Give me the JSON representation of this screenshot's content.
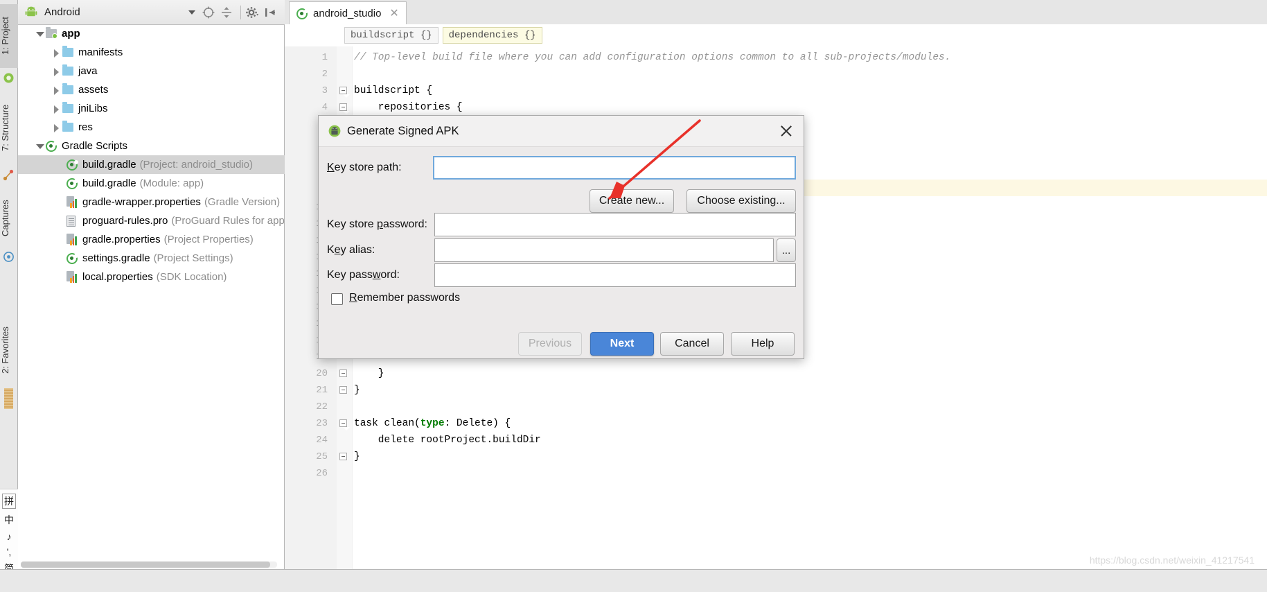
{
  "app": {
    "name": "Android Studio"
  },
  "left_strip": {
    "items": [
      {
        "label": "1: Project",
        "icon": "project-icon",
        "active": true
      },
      {
        "label": "7: Structure",
        "icon": "structure-icon",
        "active": false
      },
      {
        "label": "Captures",
        "icon": "captures-icon",
        "active": false
      },
      {
        "label": "2: Favorites",
        "icon": "favorites-icon",
        "active": false
      }
    ]
  },
  "ime": {
    "items": [
      "拼",
      "中",
      "♪",
      "',",
      "简"
    ]
  },
  "project_panel": {
    "title": "Android",
    "dropdown_icon": "chevron-down-icon",
    "toolbar_icons": [
      "target-locate-icon",
      "collapse-all-icon",
      "gear-icon",
      "hide-panel-icon"
    ],
    "tree": [
      {
        "depth": 0,
        "twist": "down",
        "icon": "folder-module-icon",
        "label": "app",
        "hint": "",
        "bold": true,
        "selected": false
      },
      {
        "depth": 1,
        "twist": "right",
        "icon": "folder-icon",
        "label": "manifests",
        "hint": "",
        "bold": false,
        "selected": false
      },
      {
        "depth": 1,
        "twist": "right",
        "icon": "folder-icon",
        "label": "java",
        "hint": "",
        "bold": false,
        "selected": false
      },
      {
        "depth": 1,
        "twist": "right",
        "icon": "folder-icon",
        "label": "assets",
        "hint": "",
        "bold": false,
        "selected": false
      },
      {
        "depth": 1,
        "twist": "right",
        "icon": "folder-icon",
        "label": "jniLibs",
        "hint": "",
        "bold": false,
        "selected": false
      },
      {
        "depth": 1,
        "twist": "right",
        "icon": "folder-icon",
        "label": "res",
        "hint": "",
        "bold": false,
        "selected": false
      },
      {
        "depth": 0,
        "twist": "down",
        "icon": "gradle-icon",
        "label": "Gradle Scripts",
        "hint": "",
        "bold": false,
        "selected": false
      },
      {
        "depth": 1,
        "twist": "none",
        "icon": "gradle-icon",
        "label": "build.gradle",
        "hint": "(Project: android_studio)",
        "bold": false,
        "selected": true
      },
      {
        "depth": 1,
        "twist": "none",
        "icon": "gradle-icon",
        "label": "build.gradle",
        "hint": "(Module: app)",
        "bold": false,
        "selected": false
      },
      {
        "depth": 1,
        "twist": "none",
        "icon": "properties-icon",
        "label": "gradle-wrapper.properties",
        "hint": "(Gradle Version)",
        "bold": false,
        "selected": false
      },
      {
        "depth": 1,
        "twist": "none",
        "icon": "document-icon",
        "label": "proguard-rules.pro",
        "hint": "(ProGuard Rules for app)",
        "bold": false,
        "selected": false
      },
      {
        "depth": 1,
        "twist": "none",
        "icon": "properties-icon",
        "label": "gradle.properties",
        "hint": "(Project Properties)",
        "bold": false,
        "selected": false
      },
      {
        "depth": 1,
        "twist": "none",
        "icon": "gradle-icon",
        "label": "settings.gradle",
        "hint": "(Project Settings)",
        "bold": false,
        "selected": false
      },
      {
        "depth": 1,
        "twist": "none",
        "icon": "properties-icon",
        "label": "local.properties",
        "hint": "(SDK Location)",
        "bold": false,
        "selected": false
      }
    ]
  },
  "editor": {
    "tab": {
      "label": "android_studio",
      "icon": "gradle-icon",
      "close_icon": "close-icon"
    },
    "breadcrumbs": [
      {
        "label": "buildscript {}",
        "highlight": false
      },
      {
        "label": "dependencies {}",
        "highlight": true
      }
    ],
    "line_count": 26,
    "highlight_line": 9,
    "code": [
      {
        "n": 1,
        "text": "// Top-level build file where you can add configuration options common to all sub-projects/modules.",
        "style": "comment"
      },
      {
        "n": 2,
        "text": "",
        "style": "plain"
      },
      {
        "n": 3,
        "text": "buildscript {",
        "style": "plain"
      },
      {
        "n": 4,
        "text": "    repositories {",
        "style": "plain"
      },
      {
        "n": 20,
        "text": "    }",
        "style": "plain"
      },
      {
        "n": 21,
        "text": "}",
        "style": "plain"
      },
      {
        "n": 22,
        "text": "",
        "style": "plain"
      },
      {
        "n": 23,
        "text": "task clean(type: Delete) {",
        "style": "keyword-type"
      },
      {
        "n": 24,
        "text": "    delete rootProject.buildDir",
        "style": "plain"
      },
      {
        "n": 25,
        "text": "}",
        "style": "plain"
      },
      {
        "n": 26,
        "text": "",
        "style": "plain"
      }
    ],
    "watermark": "https://blog.csdn.net/weixin_41217541"
  },
  "dialog": {
    "title": "Generate Signed APK",
    "title_icon": "android-icon",
    "close_icon": "close-icon",
    "fields": {
      "key_store_path": {
        "label": "Key store path:",
        "value": "",
        "focused": true
      },
      "key_store_password": {
        "label": "Key store password:",
        "value": ""
      },
      "key_alias": {
        "label": "Key alias:",
        "value": "",
        "browse_label": "..."
      },
      "key_password": {
        "label": "Key password:",
        "value": ""
      }
    },
    "buttons": {
      "create_new": "Create new...",
      "choose_existing": "Choose existing...",
      "previous": "Previous",
      "next": "Next",
      "cancel": "Cancel",
      "help": "Help"
    },
    "checkbox": {
      "label": "Remember passwords",
      "checked": false
    },
    "accent_color": "#4a86d8",
    "annotation_arrow_color": "#e8312a"
  }
}
